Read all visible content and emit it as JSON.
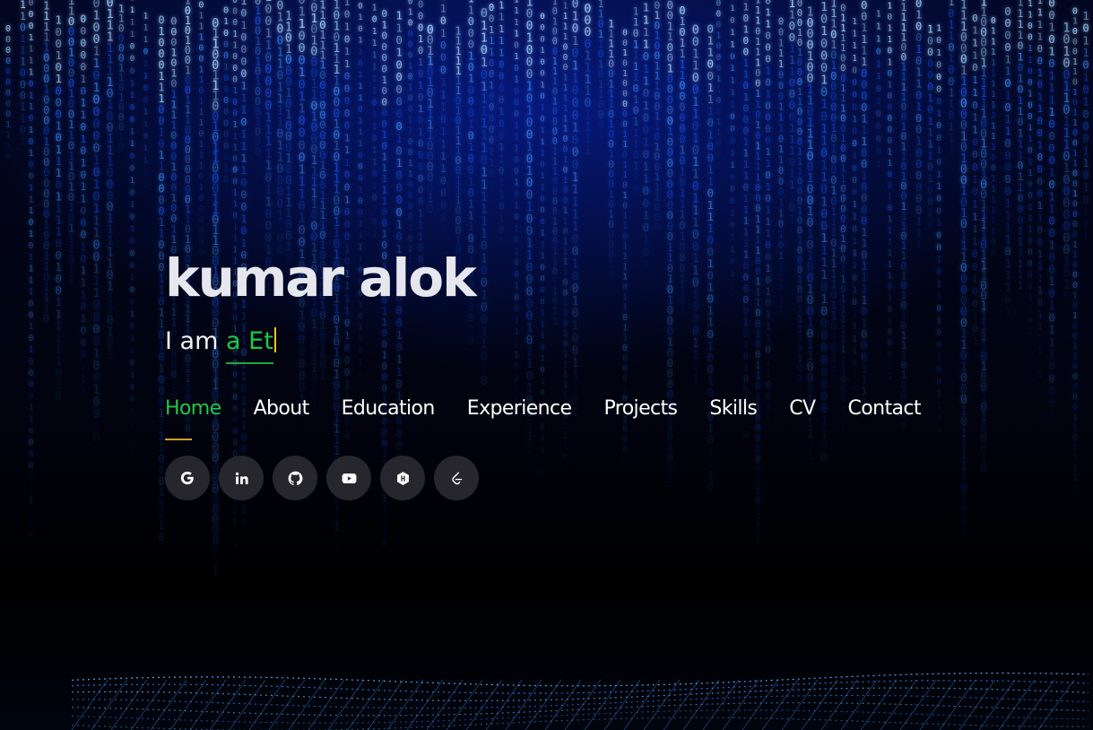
{
  "hero": {
    "name": "kumar alok",
    "tagline_prefix": "I am",
    "tagline_typed": "a Et"
  },
  "nav": {
    "items": [
      {
        "label": "Home",
        "active": true
      },
      {
        "label": "About"
      },
      {
        "label": "Education"
      },
      {
        "label": "Experience"
      },
      {
        "label": "Projects"
      },
      {
        "label": "Skills"
      },
      {
        "label": "CV"
      },
      {
        "label": "Contact"
      }
    ]
  },
  "social": [
    {
      "icon": "google-icon"
    },
    {
      "icon": "linkedin-icon"
    },
    {
      "icon": "github-icon"
    },
    {
      "icon": "youtube-icon"
    },
    {
      "icon": "hashnode-icon"
    },
    {
      "icon": "leetcode-icon"
    }
  ],
  "colors": {
    "accent_green": "#1fc747",
    "cursor_yellow": "#f5c518",
    "rain_blue": "#2a6bff"
  }
}
